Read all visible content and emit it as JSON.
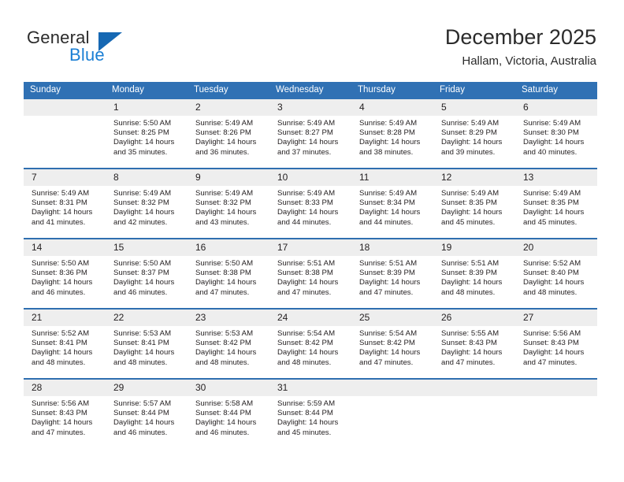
{
  "brand": {
    "name_part1": "General",
    "name_part2": "Blue"
  },
  "header": {
    "title": "December 2025",
    "location": "Hallam, Victoria, Australia"
  },
  "colors": {
    "header_blue": "#3071b4",
    "row_divider_blue": "#2f6fb0",
    "daynum_band": "#eeeeee",
    "brand_blue": "#1b7fd4",
    "text": "#231f20"
  },
  "weekdays": [
    "Sunday",
    "Monday",
    "Tuesday",
    "Wednesday",
    "Thursday",
    "Friday",
    "Saturday"
  ],
  "weeks": [
    [
      {
        "day": "",
        "l1": "",
        "l2": "",
        "l3": "",
        "l4": ""
      },
      {
        "day": "1",
        "l1": "Sunrise: 5:50 AM",
        "l2": "Sunset: 8:25 PM",
        "l3": "Daylight: 14 hours",
        "l4": "and 35 minutes."
      },
      {
        "day": "2",
        "l1": "Sunrise: 5:49 AM",
        "l2": "Sunset: 8:26 PM",
        "l3": "Daylight: 14 hours",
        "l4": "and 36 minutes."
      },
      {
        "day": "3",
        "l1": "Sunrise: 5:49 AM",
        "l2": "Sunset: 8:27 PM",
        "l3": "Daylight: 14 hours",
        "l4": "and 37 minutes."
      },
      {
        "day": "4",
        "l1": "Sunrise: 5:49 AM",
        "l2": "Sunset: 8:28 PM",
        "l3": "Daylight: 14 hours",
        "l4": "and 38 minutes."
      },
      {
        "day": "5",
        "l1": "Sunrise: 5:49 AM",
        "l2": "Sunset: 8:29 PM",
        "l3": "Daylight: 14 hours",
        "l4": "and 39 minutes."
      },
      {
        "day": "6",
        "l1": "Sunrise: 5:49 AM",
        "l2": "Sunset: 8:30 PM",
        "l3": "Daylight: 14 hours",
        "l4": "and 40 minutes."
      }
    ],
    [
      {
        "day": "7",
        "l1": "Sunrise: 5:49 AM",
        "l2": "Sunset: 8:31 PM",
        "l3": "Daylight: 14 hours",
        "l4": "and 41 minutes."
      },
      {
        "day": "8",
        "l1": "Sunrise: 5:49 AM",
        "l2": "Sunset: 8:32 PM",
        "l3": "Daylight: 14 hours",
        "l4": "and 42 minutes."
      },
      {
        "day": "9",
        "l1": "Sunrise: 5:49 AM",
        "l2": "Sunset: 8:32 PM",
        "l3": "Daylight: 14 hours",
        "l4": "and 43 minutes."
      },
      {
        "day": "10",
        "l1": "Sunrise: 5:49 AM",
        "l2": "Sunset: 8:33 PM",
        "l3": "Daylight: 14 hours",
        "l4": "and 44 minutes."
      },
      {
        "day": "11",
        "l1": "Sunrise: 5:49 AM",
        "l2": "Sunset: 8:34 PM",
        "l3": "Daylight: 14 hours",
        "l4": "and 44 minutes."
      },
      {
        "day": "12",
        "l1": "Sunrise: 5:49 AM",
        "l2": "Sunset: 8:35 PM",
        "l3": "Daylight: 14 hours",
        "l4": "and 45 minutes."
      },
      {
        "day": "13",
        "l1": "Sunrise: 5:49 AM",
        "l2": "Sunset: 8:35 PM",
        "l3": "Daylight: 14 hours",
        "l4": "and 45 minutes."
      }
    ],
    [
      {
        "day": "14",
        "l1": "Sunrise: 5:50 AM",
        "l2": "Sunset: 8:36 PM",
        "l3": "Daylight: 14 hours",
        "l4": "and 46 minutes."
      },
      {
        "day": "15",
        "l1": "Sunrise: 5:50 AM",
        "l2": "Sunset: 8:37 PM",
        "l3": "Daylight: 14 hours",
        "l4": "and 46 minutes."
      },
      {
        "day": "16",
        "l1": "Sunrise: 5:50 AM",
        "l2": "Sunset: 8:38 PM",
        "l3": "Daylight: 14 hours",
        "l4": "and 47 minutes."
      },
      {
        "day": "17",
        "l1": "Sunrise: 5:51 AM",
        "l2": "Sunset: 8:38 PM",
        "l3": "Daylight: 14 hours",
        "l4": "and 47 minutes."
      },
      {
        "day": "18",
        "l1": "Sunrise: 5:51 AM",
        "l2": "Sunset: 8:39 PM",
        "l3": "Daylight: 14 hours",
        "l4": "and 47 minutes."
      },
      {
        "day": "19",
        "l1": "Sunrise: 5:51 AM",
        "l2": "Sunset: 8:39 PM",
        "l3": "Daylight: 14 hours",
        "l4": "and 48 minutes."
      },
      {
        "day": "20",
        "l1": "Sunrise: 5:52 AM",
        "l2": "Sunset: 8:40 PM",
        "l3": "Daylight: 14 hours",
        "l4": "and 48 minutes."
      }
    ],
    [
      {
        "day": "21",
        "l1": "Sunrise: 5:52 AM",
        "l2": "Sunset: 8:41 PM",
        "l3": "Daylight: 14 hours",
        "l4": "and 48 minutes."
      },
      {
        "day": "22",
        "l1": "Sunrise: 5:53 AM",
        "l2": "Sunset: 8:41 PM",
        "l3": "Daylight: 14 hours",
        "l4": "and 48 minutes."
      },
      {
        "day": "23",
        "l1": "Sunrise: 5:53 AM",
        "l2": "Sunset: 8:42 PM",
        "l3": "Daylight: 14 hours",
        "l4": "and 48 minutes."
      },
      {
        "day": "24",
        "l1": "Sunrise: 5:54 AM",
        "l2": "Sunset: 8:42 PM",
        "l3": "Daylight: 14 hours",
        "l4": "and 48 minutes."
      },
      {
        "day": "25",
        "l1": "Sunrise: 5:54 AM",
        "l2": "Sunset: 8:42 PM",
        "l3": "Daylight: 14 hours",
        "l4": "and 47 minutes."
      },
      {
        "day": "26",
        "l1": "Sunrise: 5:55 AM",
        "l2": "Sunset: 8:43 PM",
        "l3": "Daylight: 14 hours",
        "l4": "and 47 minutes."
      },
      {
        "day": "27",
        "l1": "Sunrise: 5:56 AM",
        "l2": "Sunset: 8:43 PM",
        "l3": "Daylight: 14 hours",
        "l4": "and 47 minutes."
      }
    ],
    [
      {
        "day": "28",
        "l1": "Sunrise: 5:56 AM",
        "l2": "Sunset: 8:43 PM",
        "l3": "Daylight: 14 hours",
        "l4": "and 47 minutes."
      },
      {
        "day": "29",
        "l1": "Sunrise: 5:57 AM",
        "l2": "Sunset: 8:44 PM",
        "l3": "Daylight: 14 hours",
        "l4": "and 46 minutes."
      },
      {
        "day": "30",
        "l1": "Sunrise: 5:58 AM",
        "l2": "Sunset: 8:44 PM",
        "l3": "Daylight: 14 hours",
        "l4": "and 46 minutes."
      },
      {
        "day": "31",
        "l1": "Sunrise: 5:59 AM",
        "l2": "Sunset: 8:44 PM",
        "l3": "Daylight: 14 hours",
        "l4": "and 45 minutes."
      },
      {
        "day": "",
        "l1": "",
        "l2": "",
        "l3": "",
        "l4": ""
      },
      {
        "day": "",
        "l1": "",
        "l2": "",
        "l3": "",
        "l4": ""
      },
      {
        "day": "",
        "l1": "",
        "l2": "",
        "l3": "",
        "l4": ""
      }
    ]
  ]
}
